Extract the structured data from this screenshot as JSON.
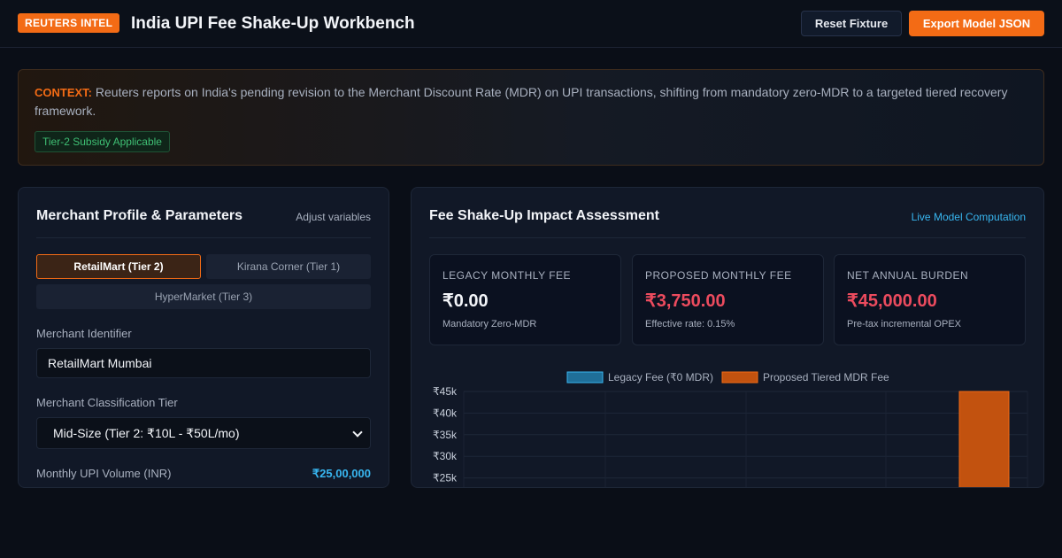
{
  "header": {
    "badge": "REUTERS INTEL",
    "title": "India UPI Fee Shake-Up Workbench",
    "reset_label": "Reset Fixture",
    "export_label": "Export Model JSON"
  },
  "context": {
    "label": "CONTEXT:",
    "text": "Reuters reports on India's pending revision to the Merchant Discount Rate (MDR) on UPI transactions, shifting from mandatory zero-MDR to a targeted tiered recovery framework.",
    "tag": "Tier-2 Subsidy Applicable"
  },
  "left_panel": {
    "title": "Merchant Profile & Parameters",
    "subtitle": "Adjust variables",
    "presets": [
      {
        "label": "RetailMart (Tier 2)",
        "active": true
      },
      {
        "label": "Kirana Corner (Tier 1)",
        "active": false
      },
      {
        "label": "HyperMarket (Tier 3)",
        "active": false
      }
    ],
    "merchant_id_label": "Merchant Identifier",
    "merchant_id_value": "RetailMart Mumbai",
    "tier_label": "Merchant Classification Tier",
    "tier_value": "Mid-Size (Tier 2: ₹10L - ₹50L/mo)",
    "volume_label": "Monthly UPI Volume (INR)",
    "volume_value": "₹25,00,000"
  },
  "right_panel": {
    "title": "Fee Shake-Up Impact Assessment",
    "subtitle": "Live Model Computation",
    "metrics": [
      {
        "label": "Legacy Monthly Fee",
        "value": "₹0.00",
        "note": "Mandatory Zero-MDR",
        "color": "#f2f4f8"
      },
      {
        "label": "Proposed Monthly Fee",
        "value": "₹3,750.00",
        "note": "Effective rate: 0.15%",
        "color": "#ec4b5e"
      },
      {
        "label": "Net Annual Burden",
        "value": "₹45,000.00",
        "note": "Pre-tax incremental OPEX",
        "color": "#ec4b5e"
      }
    ]
  },
  "colors": {
    "accent": "#f36b15",
    "legacy_series": "#1f6f99",
    "proposed_series": "#c2520f",
    "link": "#38b6f0"
  },
  "chart_data": {
    "type": "bar",
    "series": [
      {
        "name": "Legacy Fee (₹0 MDR)",
        "color": "#1f6f99",
        "stroke": "#38b6f0"
      },
      {
        "name": "Proposed Tiered MDR Fee",
        "color": "#c2520f",
        "stroke": "#f36b15",
        "values": [
          45000
        ]
      }
    ],
    "y_ticks": [
      "₹45k",
      "₹40k",
      "₹35k",
      "₹30k",
      "₹25k"
    ],
    "y_tick_values": [
      45000,
      40000,
      35000,
      30000,
      25000
    ],
    "ylim": [
      0,
      45000
    ],
    "grid": true,
    "legend": "top-center"
  }
}
